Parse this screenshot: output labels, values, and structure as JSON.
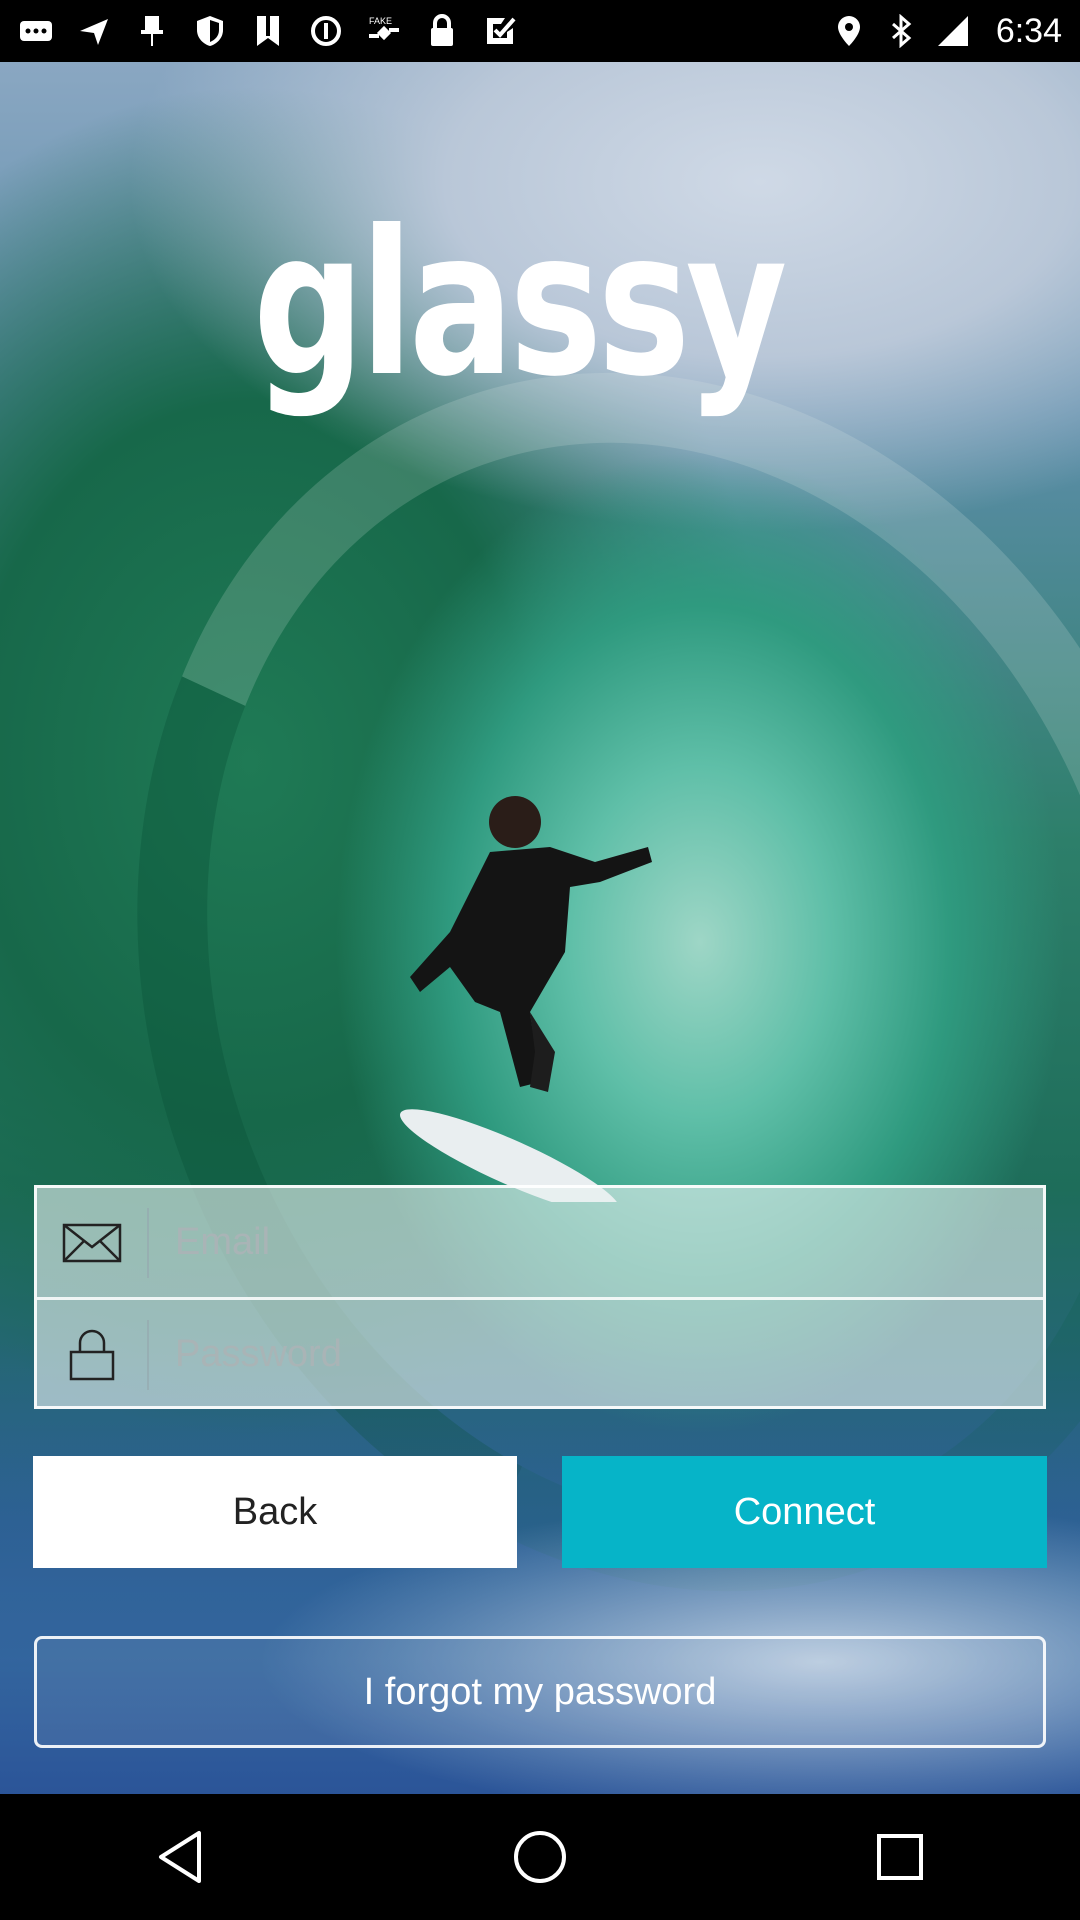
{
  "status_bar": {
    "time": "6:34",
    "left_icons": [
      "more-icon",
      "navigation-icon",
      "pin-icon",
      "shield-icon",
      "news-icon",
      "circle-icon",
      "fake-gps-icon",
      "lock-icon",
      "check-icon"
    ],
    "right_icons": [
      "location-icon",
      "bluetooth-icon",
      "signal-icon"
    ]
  },
  "logo": {
    "wordmark": "glassy",
    "pin_color": "#12b6d8"
  },
  "form": {
    "email": {
      "placeholder": "Email",
      "value": ""
    },
    "password": {
      "placeholder": "Password",
      "value": ""
    }
  },
  "buttons": {
    "back": "Back",
    "connect": "Connect",
    "forgot": "I forgot my password"
  },
  "colors": {
    "accent": "#06b4c8",
    "button_light": "#ffffff"
  },
  "nav_bar": {
    "items": [
      "back-icon",
      "home-icon",
      "recents-icon"
    ]
  }
}
